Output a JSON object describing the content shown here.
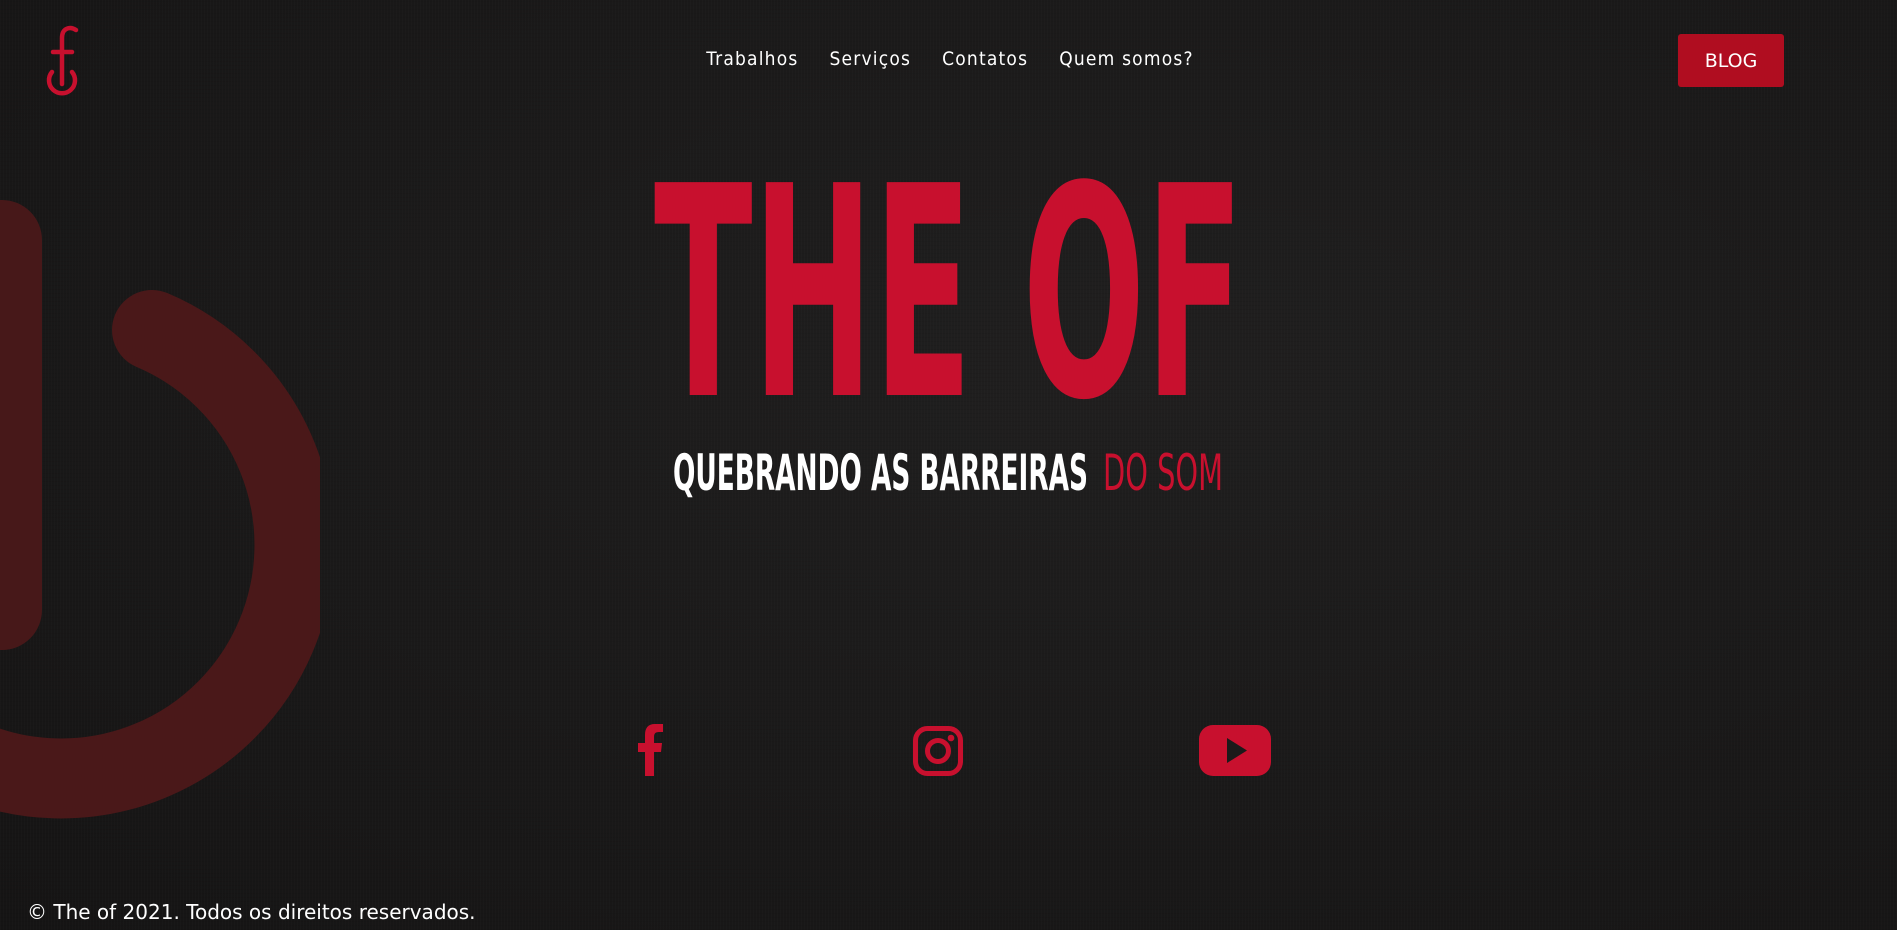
{
  "nav": {
    "items": [
      {
        "label": "Trabalhos"
      },
      {
        "label": "Serviços"
      },
      {
        "label": "Contatos"
      },
      {
        "label": "Quem somos?"
      }
    ],
    "blog_label": "BLOG"
  },
  "hero": {
    "title": "THE OF",
    "tagline_main": "QUEBRANDO AS BARREIRAS",
    "tagline_accent": "DO SOM"
  },
  "social": {
    "icons": [
      "facebook-icon",
      "instagram-icon",
      "youtube-icon"
    ]
  },
  "footer": {
    "text": "© The of 2021. Todos os direitos reservados."
  },
  "colors": {
    "accent": "#c8102e",
    "button": "#b00d20",
    "background": "#1b1a1a",
    "bg_mark": "#4a1819"
  }
}
